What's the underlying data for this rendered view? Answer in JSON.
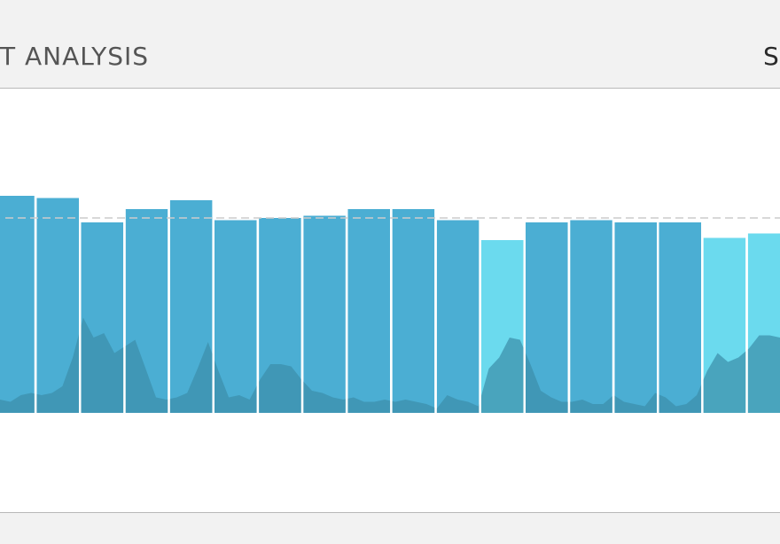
{
  "header": {
    "title": "T ANALYSIS",
    "right_label": "S"
  },
  "chart_data": {
    "type": "bar",
    "ylim": [
      0,
      100
    ],
    "grid": false,
    "average_line": 88,
    "values": [
      98,
      97,
      86,
      92,
      96,
      87,
      88,
      89,
      92,
      92,
      87,
      78,
      86,
      87,
      86,
      86,
      79,
      81
    ],
    "highlight": [
      false,
      false,
      false,
      false,
      false,
      false,
      false,
      false,
      false,
      false,
      false,
      true,
      false,
      false,
      false,
      false,
      true,
      true
    ],
    "overlay_area": [
      6,
      5,
      8,
      9,
      8,
      9,
      12,
      25,
      43,
      34,
      36,
      27,
      30,
      33,
      20,
      7,
      6,
      7,
      9,
      20,
      32,
      19,
      7,
      8,
      6,
      15,
      22,
      22,
      21,
      15,
      10,
      9,
      7,
      6,
      7,
      5,
      5,
      6,
      5,
      6,
      5,
      4,
      2,
      8,
      6,
      5,
      3,
      20,
      25,
      34,
      33,
      22,
      10,
      7,
      5,
      5,
      6,
      4,
      4,
      8,
      5,
      4,
      3,
      9,
      7,
      3,
      4,
      8,
      19,
      27,
      23,
      25,
      29,
      35,
      35,
      34
    ],
    "colors": {
      "bar": "#4baed3",
      "bar_highlight": "#6bdaee",
      "overlay": "#3b8fab",
      "average_line": "#cccccc",
      "separator": "#ffffff"
    }
  }
}
